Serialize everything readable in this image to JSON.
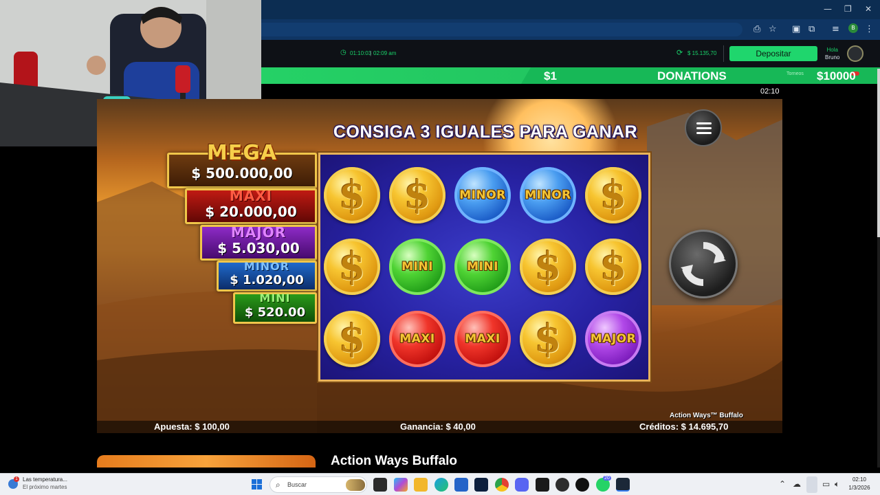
{
  "browser": {
    "window_controls": [
      "—",
      "❐",
      "✕"
    ]
  },
  "site_header": {
    "session_time": "01:10:03",
    "clock_time": "02:09 am",
    "balance": "$ 15.135,70",
    "deposit_label": "Depositar",
    "greeting": "Hola",
    "username": "Bruno",
    "avatar_letter": "B"
  },
  "ticker": {
    "left_amount": "$1",
    "title": "DONATIONS",
    "right_amount": "$10000",
    "torneos": "Torneos",
    "timer": "02:10"
  },
  "game": {
    "headline": "CONSIGA 3 IGUALES PARA GANAR",
    "jackpots": [
      {
        "name": "MEGA",
        "value": "$ 500.000,00",
        "color": "#f3c93e"
      },
      {
        "name": "MAXI",
        "value": "$ 20.000,00",
        "color": "#ef3b2b"
      },
      {
        "name": "MAJOR",
        "value": "$ 5.030,00",
        "color": "#b84be6"
      },
      {
        "name": "MINOR",
        "value": "$ 1.020,00",
        "color": "#3d8ff0"
      },
      {
        "name": "MINI",
        "value": "$ 520.00",
        "color": "#4cc32c"
      }
    ],
    "grid": [
      [
        {
          "type": "gold",
          "label": "$"
        },
        {
          "type": "gold",
          "label": "$"
        },
        {
          "type": "blue",
          "label": "MINOR"
        },
        {
          "type": "blue",
          "label": "MINOR"
        },
        {
          "type": "gold",
          "label": "$"
        }
      ],
      [
        {
          "type": "gold",
          "label": "$"
        },
        {
          "type": "green",
          "label": "MINI"
        },
        {
          "type": "green",
          "label": "MINI"
        },
        {
          "type": "gold",
          "label": "$"
        },
        {
          "type": "gold",
          "label": "$"
        }
      ],
      [
        {
          "type": "gold",
          "label": "$"
        },
        {
          "type": "red",
          "label": "MAXI"
        },
        {
          "type": "red",
          "label": "MAXI"
        },
        {
          "type": "gold",
          "label": "$"
        },
        {
          "type": "purple",
          "label": "MAJOR"
        }
      ]
    ],
    "bet": "Apuesta: $ 100,00",
    "win": "Ganancia: $ 40,00",
    "credits": "Créditos: $ 14.695,70",
    "game_name": "Action Ways™ Buffalo"
  },
  "page": {
    "game_title": "Action Ways Buffalo"
  },
  "taskbar": {
    "weather_title": "Las temperatura...",
    "weather_sub": "El próximo martes",
    "weather_badge": "1",
    "search_placeholder": "Buscar",
    "time": "02:10",
    "date": "1/3/2026",
    "discord_badge": "20"
  }
}
